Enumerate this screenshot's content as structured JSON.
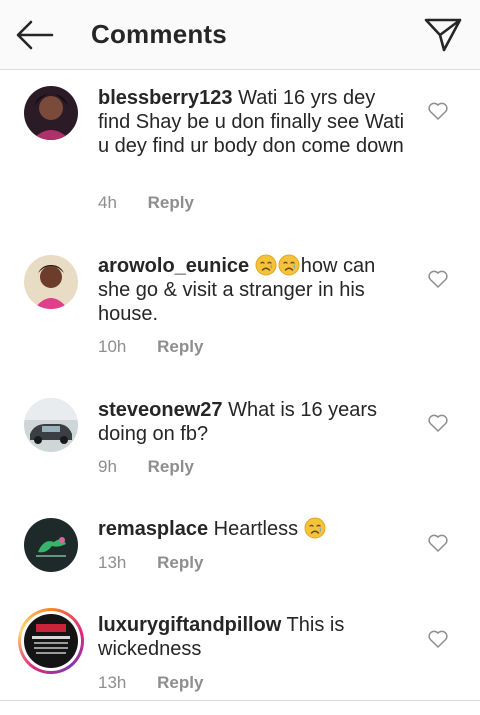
{
  "header": {
    "title": "Comments",
    "back_icon": "arrow-left-icon",
    "send_icon": "paper-plane-icon"
  },
  "reply_label": "Reply",
  "comments": [
    {
      "username": "blessberry123",
      "text": "Wati 16 yrs dey find Shay be u don finally see Wati u dey find ur body don come down",
      "time": "4h"
    },
    {
      "username": "arowolo_eunice",
      "emoji": "crying-face-icon x2",
      "text": "how can she go & visit a stranger in his house.",
      "time": "10h"
    },
    {
      "username": "steveonew27",
      "text": "What is 16 years doing on fb?",
      "time": "9h"
    },
    {
      "username": "remasplace",
      "text": "Heartless",
      "emoji": "crying-face-icon",
      "time": "13h"
    },
    {
      "username": "luxurygiftandpillow",
      "text": "This is wickedness",
      "time": "13h"
    }
  ]
}
